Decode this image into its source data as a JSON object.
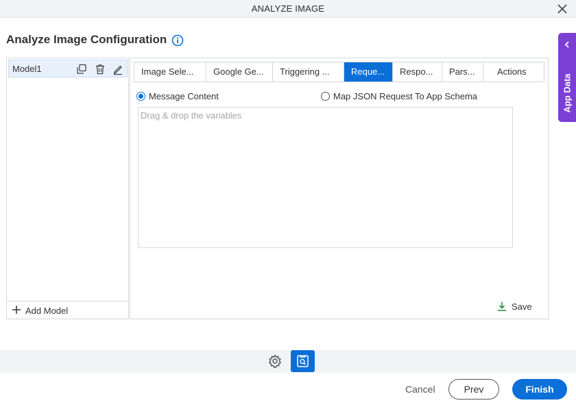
{
  "window": {
    "title": "ANALYZE IMAGE",
    "close_icon": "close-icon"
  },
  "page": {
    "heading": "Analyze Image Configuration",
    "info_icon": "info-icon"
  },
  "models": {
    "items": [
      {
        "label": "Model1",
        "icons": [
          "duplicate-icon",
          "delete-icon",
          "edit-icon"
        ]
      }
    ],
    "add_label": "Add Model"
  },
  "tabs": [
    {
      "label": "Image Sele...",
      "active": false
    },
    {
      "label": "Google Ge...",
      "active": false
    },
    {
      "label": "Triggering ...",
      "active": false
    },
    {
      "label": "Reque...",
      "active": true
    },
    {
      "label": "Respo...",
      "active": false
    },
    {
      "label": "Pars...",
      "active": false
    },
    {
      "label": "Actions",
      "active": false
    }
  ],
  "request": {
    "options": [
      {
        "label": "Message Content",
        "selected": true
      },
      {
        "label": "Map JSON Request To App Schema",
        "selected": false
      }
    ],
    "dropzone_placeholder": "Drag & drop the variables",
    "save_label": "Save"
  },
  "side_panel": {
    "label": "App Data"
  },
  "footer": {
    "cancel_label": "Cancel",
    "prev_label": "Prev",
    "finish_label": "Finish"
  },
  "colors": {
    "primary": "#0a6fd8",
    "app_data": "#7b3fd4",
    "save_icon": "#2e8b3e"
  }
}
